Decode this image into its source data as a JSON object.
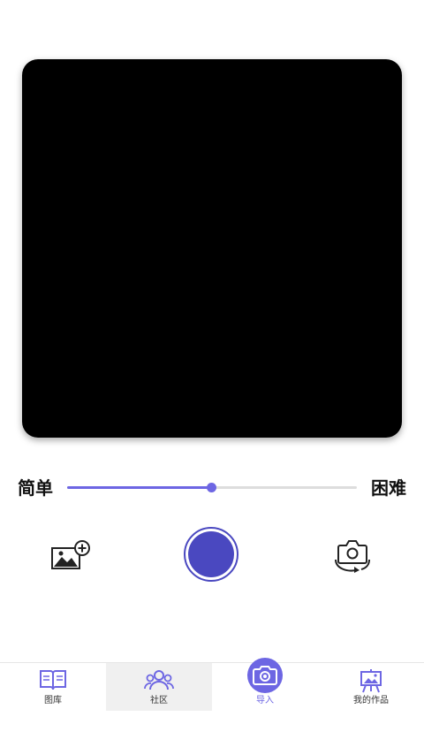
{
  "difficulty": {
    "easy_label": "简单",
    "hard_label": "困难",
    "value": 0.5
  },
  "controls": {
    "add_image_icon": "image-add-icon",
    "shutter": "shutter-button",
    "switch_camera_icon": "camera-switch-icon"
  },
  "nav": {
    "items": [
      {
        "label": "图库",
        "icon": "book-icon"
      },
      {
        "label": "社区",
        "icon": "people-icon"
      },
      {
        "label": "导入",
        "icon": "camera-icon"
      },
      {
        "label": "我的作品",
        "icon": "easel-icon"
      }
    ]
  },
  "colors": {
    "accent": "#6d66e3",
    "shutter": "#4a48c0",
    "preview": "#000000"
  }
}
